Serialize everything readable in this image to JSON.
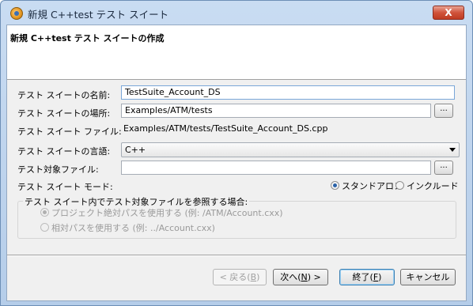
{
  "window": {
    "title": "新規 C++test テスト スイート",
    "close_label": "X"
  },
  "header": {
    "title": "新規 C++test テスト スイートの作成"
  },
  "form": {
    "name_label": "テスト スイートの名前:",
    "name_value": "TestSuite_Account_DS",
    "location_label": "テスト スイートの場所:",
    "location_value": "Examples/ATM/tests",
    "file_label": "テスト スイート ファイル:",
    "file_value": "Examples/ATM/tests/TestSuite_Account_DS.cpp",
    "language_label": "テスト スイートの言語:",
    "language_value": "C++",
    "target_label": "テスト対象ファイル:",
    "target_value": "",
    "browse_label": "...",
    "mode_label": "テスト スイート モード:",
    "mode_options": [
      "スタンドアロン",
      "インクルード"
    ],
    "mode_selected": "スタンドアロン"
  },
  "group": {
    "title": "テスト スイート内でテスト対象ファイルを参照する場合:",
    "options": [
      "プロジェクト絶対パスを使用する (例: /ATM/Account.cxx)",
      "相対パスを使用する (例: ../Account.cxx)"
    ],
    "selected_index": 0
  },
  "buttons": {
    "back": "< 戻る(",
    "back_key": "B",
    "next": "次へ(",
    "next_key": "N",
    "finish": "終了(",
    "finish_key": "F",
    "cancel": "キャンセル",
    "close_paren": ")",
    "close_paren_next": ") >"
  }
}
